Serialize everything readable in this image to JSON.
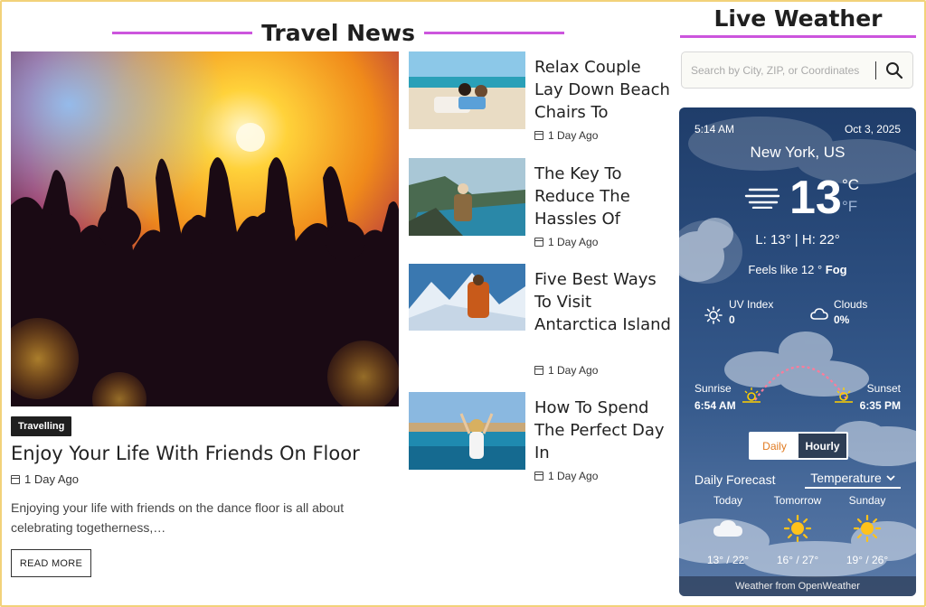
{
  "travel_news": {
    "heading": "Travel News",
    "hero": {
      "badge": "Travelling",
      "title": "Enjoy Your Life With Friends On Floor",
      "date": "1 Day Ago",
      "excerpt": "Enjoying your life with friends on the dance floor is all about celebrating togetherness,…",
      "button": "READ MORE"
    },
    "articles": [
      {
        "title": "Relax Couple Lay Down Beach Chairs To",
        "date": "1 Day Ago"
      },
      {
        "title": "The Key To Reduce The Hassles Of",
        "date": "1 Day Ago"
      },
      {
        "title": "Five Best Ways To Visit Antarctica Island",
        "date": "1 Day Ago"
      },
      {
        "title": "How To Spend The Perfect Day In",
        "date": "1 Day Ago"
      }
    ]
  },
  "weather": {
    "heading": "Live Weather",
    "search_placeholder": "Search by City, ZIP, or Coordinates",
    "time": "5:14 AM",
    "date": "Oct 3, 2025",
    "city": "New York, US",
    "temperature": "13",
    "unit_c": "°C",
    "unit_f": "°F",
    "low_high": "L: 13°  |  H: 22°",
    "feels_like": "Feels like 12 °",
    "condition": "Fog",
    "uv_label": "UV Index",
    "uv_value": "0",
    "clouds_label": "Clouds",
    "clouds_value": "0%",
    "sunrise_label": "Sunrise",
    "sunrise_time": "6:54 AM",
    "sunset_label": "Sunset",
    "sunset_time": "6:35 PM",
    "toggle_daily": "Daily",
    "toggle_hourly": "Hourly",
    "forecast_title": "Daily Forecast",
    "forecast_select": "Temperature",
    "forecast": [
      {
        "day": "Today",
        "icon": "cloud-icon",
        "temp": "13° / 22°"
      },
      {
        "day": "Tomorrow",
        "icon": "sun-icon",
        "temp": "16° / 27°"
      },
      {
        "day": "Sunday",
        "icon": "sun-icon",
        "temp": "19° / 26°"
      }
    ],
    "footer": "Weather from OpenWeather",
    "accent_color": "#cc55dd",
    "daily_color": "#e07a20"
  }
}
